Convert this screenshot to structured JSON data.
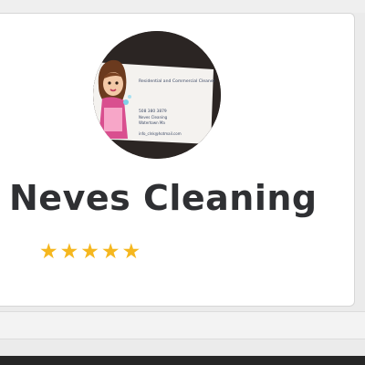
{
  "business": {
    "name": "Neves Cleaning",
    "rating": 5,
    "stars": [
      "★",
      "★",
      "★",
      "★",
      "★"
    ]
  },
  "card_photo": {
    "headline": "Residential and Commercial Cleaner",
    "phone": "508 380 3879",
    "company": "Neves Cleaning",
    "location": "Watertown Ma",
    "email": "info_clnk@hotmail.com"
  },
  "colors": {
    "star": "#f5b71f",
    "name_text": "#2f3033",
    "bottom_bar": "#262626"
  }
}
